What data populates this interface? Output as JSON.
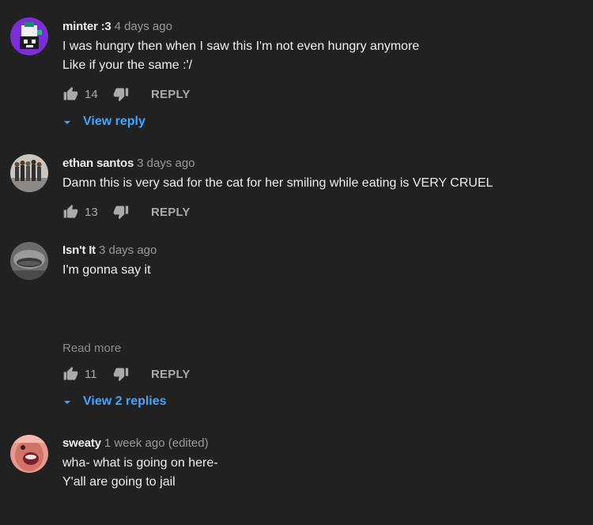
{
  "comments": [
    {
      "author": "minter :3",
      "time": "4 days ago",
      "lines": [
        "I was hungry then when I saw this I'm not even hungry anymore",
        "Like if your the same :'/"
      ],
      "likes": "14",
      "reply_label": "REPLY",
      "view_replies": "View reply"
    },
    {
      "author": "ethan santos",
      "time": "3 days ago",
      "lines": [
        "Damn this is very sad for the cat for her smiling while eating is VERY CRUEL"
      ],
      "likes": "13",
      "reply_label": "REPLY"
    },
    {
      "author": "Isn't It",
      "time": "3 days ago",
      "lines": [
        "I'm gonna say it"
      ],
      "read_more": "Read more",
      "likes": "11",
      "reply_label": "REPLY",
      "view_replies": "View 2 replies"
    },
    {
      "author": "sweaty",
      "time": "1 week ago (edited)",
      "lines": [
        "wha- what is going on here-",
        "Y'all are going to jail"
      ]
    }
  ],
  "colors": {
    "background": "#212121",
    "link_blue": "#3ea6ff",
    "secondary_text": "#aaaaaa"
  }
}
